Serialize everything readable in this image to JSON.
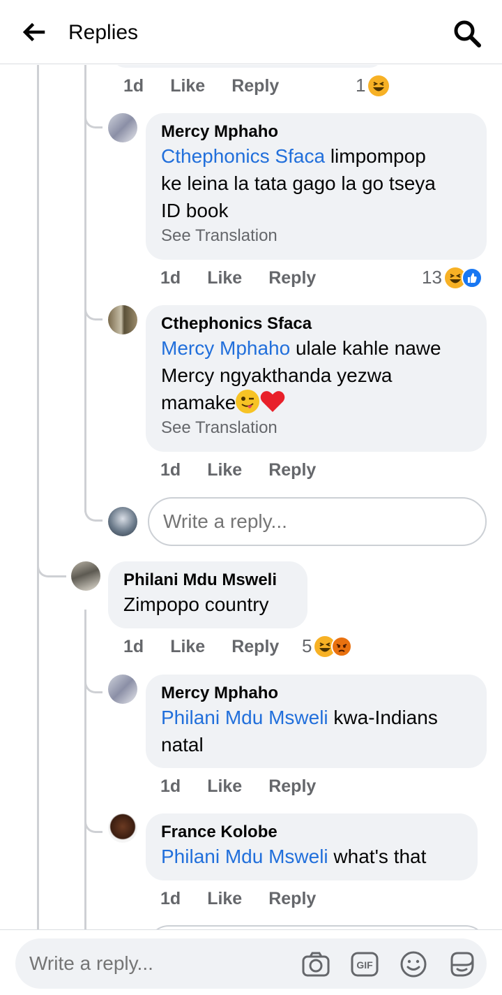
{
  "header": {
    "title": "Replies"
  },
  "threads": [
    {
      "meta": {
        "time": "1d",
        "like": "Like",
        "reply": "Reply"
      },
      "reactions": {
        "count": "1",
        "icons": [
          "haha-icon"
        ]
      }
    },
    {
      "name": "Mercy Mphaho",
      "mention": "Cthephonics Sfaca",
      "text_line1": " limpompop",
      "text_line2": "ke leina la tata gago la go tseya",
      "text_line3": "ID book",
      "translate": "See Translation",
      "meta": {
        "time": "1d",
        "like": "Like",
        "reply": "Reply"
      },
      "reactions": {
        "count": "13",
        "icons": [
          "haha-icon",
          "like-icon"
        ]
      }
    },
    {
      "name": "Cthephonics Sfaca",
      "mention": "Mercy Mphaho",
      "text_line1": " ulale kahle nawe",
      "text_line2": "Mercy ngyakthanda yezwa",
      "text_line3": "mamake",
      "translate": "See Translation",
      "meta": {
        "time": "1d",
        "like": "Like",
        "reply": "Reply"
      }
    },
    {
      "placeholder": "Write a reply..."
    },
    {
      "name": "Philani Mdu Msweli",
      "text": "Zimpopo country",
      "meta": {
        "time": "1d",
        "like": "Like",
        "reply": "Reply"
      },
      "reactions": {
        "count": "5",
        "icons": [
          "haha-icon",
          "angry-icon"
        ]
      }
    },
    {
      "name": "Mercy Mphaho",
      "mention": "Philani Mdu Msweli",
      "text_line1": " kwa-Indians",
      "text_line2": "natal",
      "meta": {
        "time": "1d",
        "like": "Like",
        "reply": "Reply"
      }
    },
    {
      "name": "France Kolobe",
      "mention": "Philani Mdu Msweli",
      "text_line1": " what's that",
      "meta": {
        "time": "1d",
        "like": "Like",
        "reply": "Reply"
      }
    }
  ],
  "composer": {
    "placeholder": "Write a reply..."
  },
  "icons": {
    "back": "arrow-left-icon",
    "search": "search-icon",
    "camera": "camera-icon",
    "gif": "gif-icon",
    "emoji": "emoji-icon",
    "sticker": "sticker-icon"
  },
  "colors": {
    "mention": "#216fdb",
    "bubble": "#f0f2f5",
    "meta": "#65676b",
    "haha": "#f7b125",
    "like": "#1877f2",
    "angry": "#e9710f"
  }
}
